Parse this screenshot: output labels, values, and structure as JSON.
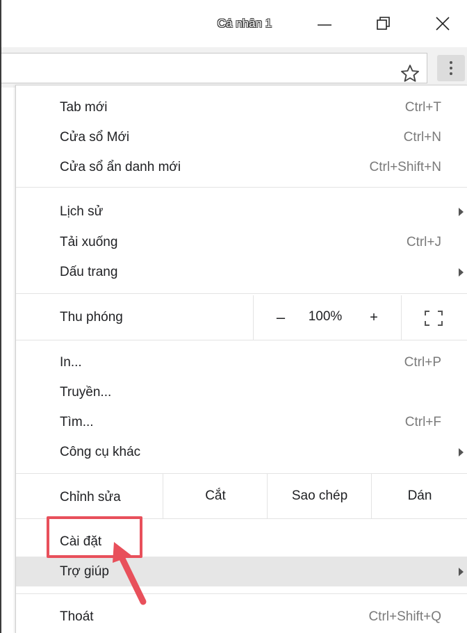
{
  "window": {
    "profile_name": "Cá nhân 1",
    "minimize_icon": "minimize-icon",
    "restore_icon": "restore-icon",
    "close_icon": "close-icon"
  },
  "toolbar": {
    "bookmark_icon": "star-icon",
    "menu_icon": "kebab-menu-icon"
  },
  "menu": {
    "group1": [
      {
        "label": "Tab mới",
        "shortcut": "Ctrl+T"
      },
      {
        "label": "Cửa sổ Mới",
        "shortcut": "Ctrl+N"
      },
      {
        "label": "Cửa sổ ẩn danh mới",
        "shortcut": "Ctrl+Shift+N"
      }
    ],
    "group2": [
      {
        "label": "Lịch sử",
        "shortcut": "",
        "submenu": true
      },
      {
        "label": "Tải xuống",
        "shortcut": "Ctrl+J"
      },
      {
        "label": "Dấu trang",
        "shortcut": "",
        "submenu": true
      }
    ],
    "zoom": {
      "label": "Thu phóng",
      "minus": "–",
      "value": "100%",
      "plus": "+",
      "fullscreen_icon": "fullscreen-icon"
    },
    "group3": [
      {
        "label": "In...",
        "shortcut": "Ctrl+P"
      },
      {
        "label": "Truyền...",
        "shortcut": ""
      },
      {
        "label": "Tìm...",
        "shortcut": "Ctrl+F"
      },
      {
        "label": "Công cụ khác",
        "shortcut": "",
        "submenu": true
      }
    ],
    "edit": {
      "label": "Chỉnh sửa",
      "cut": "Cắt",
      "copy": "Sao chép",
      "paste": "Dán"
    },
    "group4": [
      {
        "label": "Cài đặt",
        "shortcut": ""
      },
      {
        "label": "Trợ giúp",
        "shortcut": "",
        "submenu": true,
        "highlighted": true
      }
    ],
    "group5": [
      {
        "label": "Thoát",
        "shortcut": "Ctrl+Shift+Q"
      }
    ]
  },
  "colors": {
    "annotation": "#e8505b",
    "highlight": "#e6e6e6",
    "shortcut_text": "#7a7a7a"
  }
}
